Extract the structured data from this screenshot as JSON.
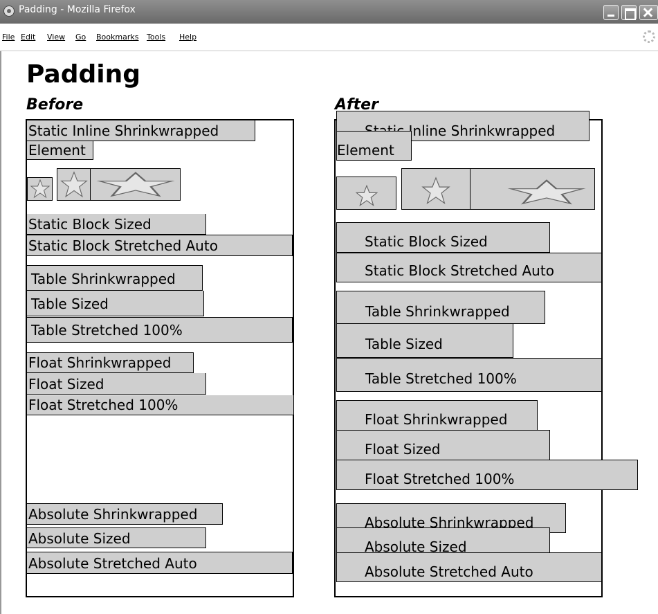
{
  "window": {
    "title": "Padding - Mozilla Firefox",
    "menu": [
      "File",
      "Edit",
      "View",
      "Go",
      "Bookmarks",
      "Tools",
      "Help"
    ]
  },
  "page": {
    "title": "Padding",
    "before_heading": "Before",
    "after_heading": "After"
  },
  "items": {
    "static_inline_line1": "Static Inline Shrinkwrapped",
    "static_inline_line2": "Element",
    "static_block_sized": "Static Block Sized",
    "static_block_stretched": "Static Block Stretched Auto",
    "table_shrinkwrapped": "Table Shrinkwrapped",
    "table_sized": "Table Sized",
    "table_stretched": "Table Stretched 100%",
    "float_shrinkwrapped": "Float Shrinkwrapped",
    "float_sized": "Float Sized",
    "float_stretched": "Float Stretched 100%",
    "absolute_shrinkwrapped": "Absolute Shrinkwrapped",
    "absolute_sized": "Absolute Sized",
    "absolute_stretched": "Absolute Stretched Auto"
  },
  "icons": {
    "app": "firefox-icon",
    "star": "star-image"
  },
  "colors": {
    "box_fill": "#cfcfcf",
    "titlebar": "#7a7a7a"
  }
}
